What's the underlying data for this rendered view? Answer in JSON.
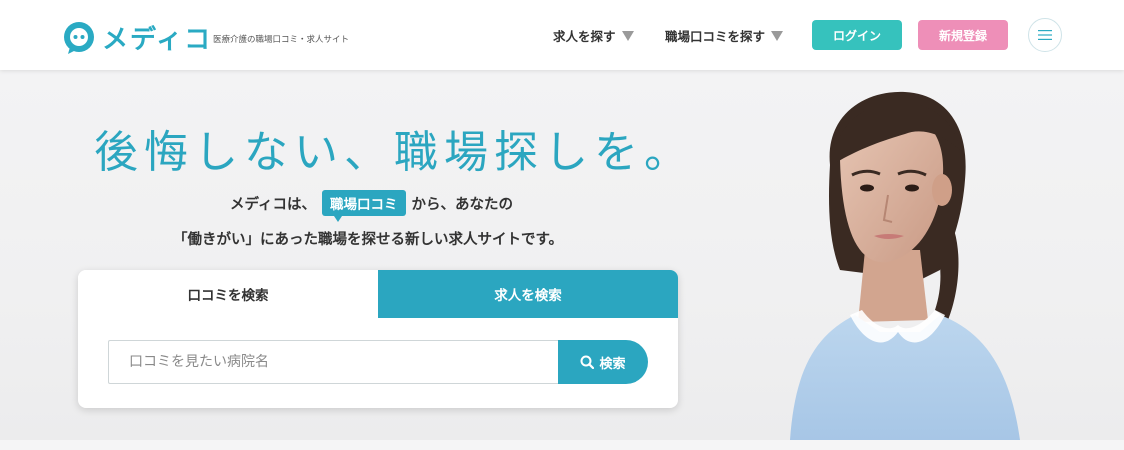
{
  "header": {
    "logo_text": "メディコ",
    "tagline": "医療介護の職場口コミ・求人サイト",
    "nav": [
      {
        "label": "求人を探す"
      },
      {
        "label": "職場口コミを探す"
      }
    ],
    "login_label": "ログイン",
    "register_label": "新規登録",
    "menu_icon": "hamburger-icon"
  },
  "hero": {
    "headline": "後悔しない、職場探しを。",
    "intro_before": "メディコは、",
    "intro_badge": "職場口コミ",
    "intro_after": "から、あなたの",
    "intro_line2": "「働きがい」にあった職場を探せる新しい求人サイトです。"
  },
  "search": {
    "tabs": [
      {
        "label": "口コミを検索"
      },
      {
        "label": "求人を検索"
      }
    ],
    "placeholder": "口コミを見たい病院名",
    "button_label": "検索",
    "button_icon": "search-icon"
  },
  "colors": {
    "brand": "#2ba6c0",
    "login": "#36c2bd",
    "register": "#ee8fb8"
  }
}
